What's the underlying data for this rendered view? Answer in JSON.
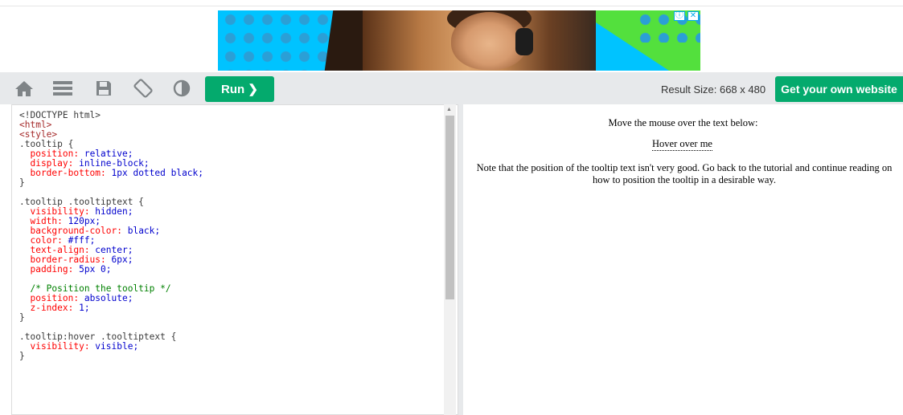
{
  "ad": {
    "info_label": "ⓘ",
    "close_label": "✕"
  },
  "toolbar": {
    "run_label": "Run ❯",
    "result_size": "Result Size: 668 x 480",
    "get_website_label": "Get your own website",
    "icons": [
      "home-icon",
      "menu-icon",
      "save-icon",
      "rotate-icon",
      "theme-icon"
    ]
  },
  "code": {
    "lines": [
      [
        {
          "t": "<!DOCTYPE html>",
          "c": "plain"
        }
      ],
      [
        {
          "t": "<html>",
          "c": "tag"
        }
      ],
      [
        {
          "t": "<style>",
          "c": "tag"
        }
      ],
      [
        {
          "t": ".tooltip {",
          "c": "plain"
        }
      ],
      [
        {
          "t": "  position: ",
          "c": "prop"
        },
        {
          "t": "relative;",
          "c": "val"
        }
      ],
      [
        {
          "t": "  display: ",
          "c": "prop"
        },
        {
          "t": "inline-block;",
          "c": "val"
        }
      ],
      [
        {
          "t": "  border-bottom: ",
          "c": "prop"
        },
        {
          "t": "1px dotted black;",
          "c": "val"
        }
      ],
      [
        {
          "t": "}",
          "c": "plain"
        }
      ],
      [
        {
          "t": "",
          "c": "plain"
        }
      ],
      [
        {
          "t": ".tooltip .tooltiptext {",
          "c": "plain"
        }
      ],
      [
        {
          "t": "  visibility: ",
          "c": "prop"
        },
        {
          "t": "hidden;",
          "c": "val"
        }
      ],
      [
        {
          "t": "  width: ",
          "c": "prop"
        },
        {
          "t": "120px;",
          "c": "val"
        }
      ],
      [
        {
          "t": "  background-color: ",
          "c": "prop"
        },
        {
          "t": "black;",
          "c": "val"
        }
      ],
      [
        {
          "t": "  color: ",
          "c": "prop"
        },
        {
          "t": "#fff;",
          "c": "val"
        }
      ],
      [
        {
          "t": "  text-align: ",
          "c": "prop"
        },
        {
          "t": "center;",
          "c": "val"
        }
      ],
      [
        {
          "t": "  border-radius: ",
          "c": "prop"
        },
        {
          "t": "6px;",
          "c": "val"
        }
      ],
      [
        {
          "t": "  padding: ",
          "c": "prop"
        },
        {
          "t": "5px 0;",
          "c": "val"
        }
      ],
      [
        {
          "t": "",
          "c": "plain"
        }
      ],
      [
        {
          "t": "  /* Position the tooltip */",
          "c": "com"
        }
      ],
      [
        {
          "t": "  position: ",
          "c": "prop"
        },
        {
          "t": "absolute;",
          "c": "val"
        }
      ],
      [
        {
          "t": "  z-index: ",
          "c": "prop"
        },
        {
          "t": "1;",
          "c": "val"
        }
      ],
      [
        {
          "t": "}",
          "c": "plain"
        }
      ],
      [
        {
          "t": "",
          "c": "plain"
        }
      ],
      [
        {
          "t": ".tooltip:hover .tooltiptext {",
          "c": "plain"
        }
      ],
      [
        {
          "t": "  visibility: ",
          "c": "prop"
        },
        {
          "t": "visible;",
          "c": "val"
        }
      ],
      [
        {
          "t": "}",
          "c": "plain"
        }
      ]
    ]
  },
  "result": {
    "line1": "Move the mouse over the text below:",
    "hover_text": "Hover over me",
    "note": "Note that the position of the tooltip text isn't very good. Go back to the tutorial and continue reading on how to position the tooltip in a desirable way."
  },
  "colors": {
    "toolbar_bg": "#e7e9eb",
    "accent_green": "#04aa6d"
  }
}
